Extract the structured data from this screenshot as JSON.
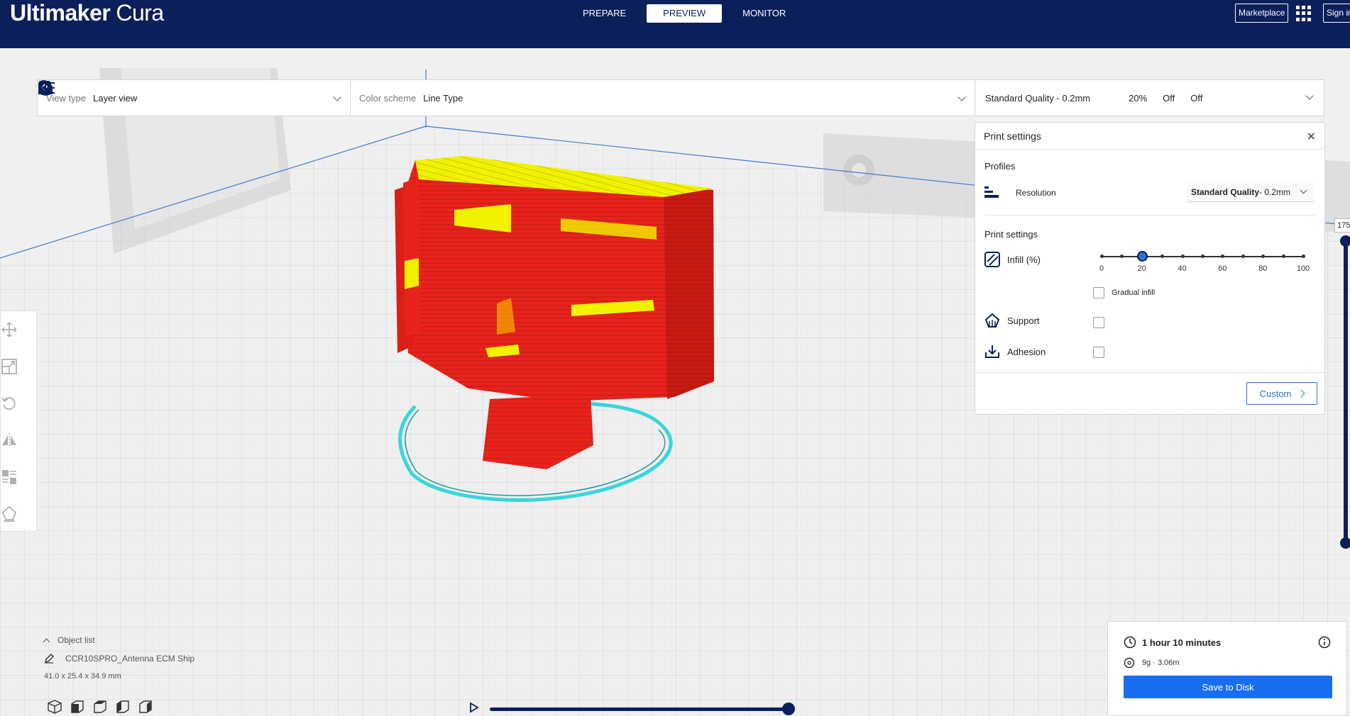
{
  "app": {
    "title_bold": "Ultimaker",
    "title_light": "Cura"
  },
  "stages": [
    {
      "label": "PREPARE",
      "active": false
    },
    {
      "label": "PREVIEW",
      "active": true
    },
    {
      "label": "MONITOR",
      "active": false
    }
  ],
  "header": {
    "marketplace": "Marketplace",
    "sign_in": "Sign in"
  },
  "topbar": {
    "view_type_label": "View type",
    "view_type_value": "Layer view",
    "color_scheme_label": "Color scheme",
    "color_scheme_value": "Line Type",
    "profile": "Standard Quality - 0.2mm",
    "infill": "20%",
    "support": "Off",
    "adhesion": "Off"
  },
  "print_settings": {
    "title": "Print settings",
    "profiles_heading": "Profiles",
    "resolution_label": "Resolution",
    "resolution_value_bold": "Standard Quality",
    "resolution_value_rest": " - 0.2mm",
    "settings_heading": "Print settings",
    "infill_label": "Infill (%)",
    "infill_value": 20,
    "infill_ticks": [
      "0",
      "20",
      "40",
      "60",
      "80",
      "100"
    ],
    "gradual_infill_label": "Gradual infill",
    "gradual_infill_checked": false,
    "support_label": "Support",
    "support_checked": false,
    "adhesion_label": "Adhesion",
    "adhesion_checked": false,
    "custom_button": "Custom"
  },
  "layer_slider": {
    "top_layer": "175"
  },
  "object_list": {
    "header": "Object list",
    "object_name": "CCR10SPRO_Antenna ECM Ship",
    "dimensions": "41.0 x 25.4 x 34.9 mm"
  },
  "estimate": {
    "time": "1 hour 10 minutes",
    "material": "9g · 3.06m",
    "save_button": "Save to Disk"
  },
  "colors": {
    "header_bg": "#0b1f5a",
    "accent": "#196ef0",
    "model_wall": "#e8231b",
    "model_top": "#f2f200",
    "skirt": "#38d6dc"
  },
  "icons": [
    "move-icon",
    "scale-icon",
    "rotate-icon",
    "mirror-icon",
    "per-model-settings-icon",
    "support-blocker-icon",
    "apps-grid-icon",
    "profile-sliders-icon",
    "infill-icon",
    "support-icon",
    "adhesion-icon",
    "close-icon",
    "clock-icon",
    "spool-icon",
    "info-icon",
    "play-icon",
    "pencil-icon"
  ]
}
